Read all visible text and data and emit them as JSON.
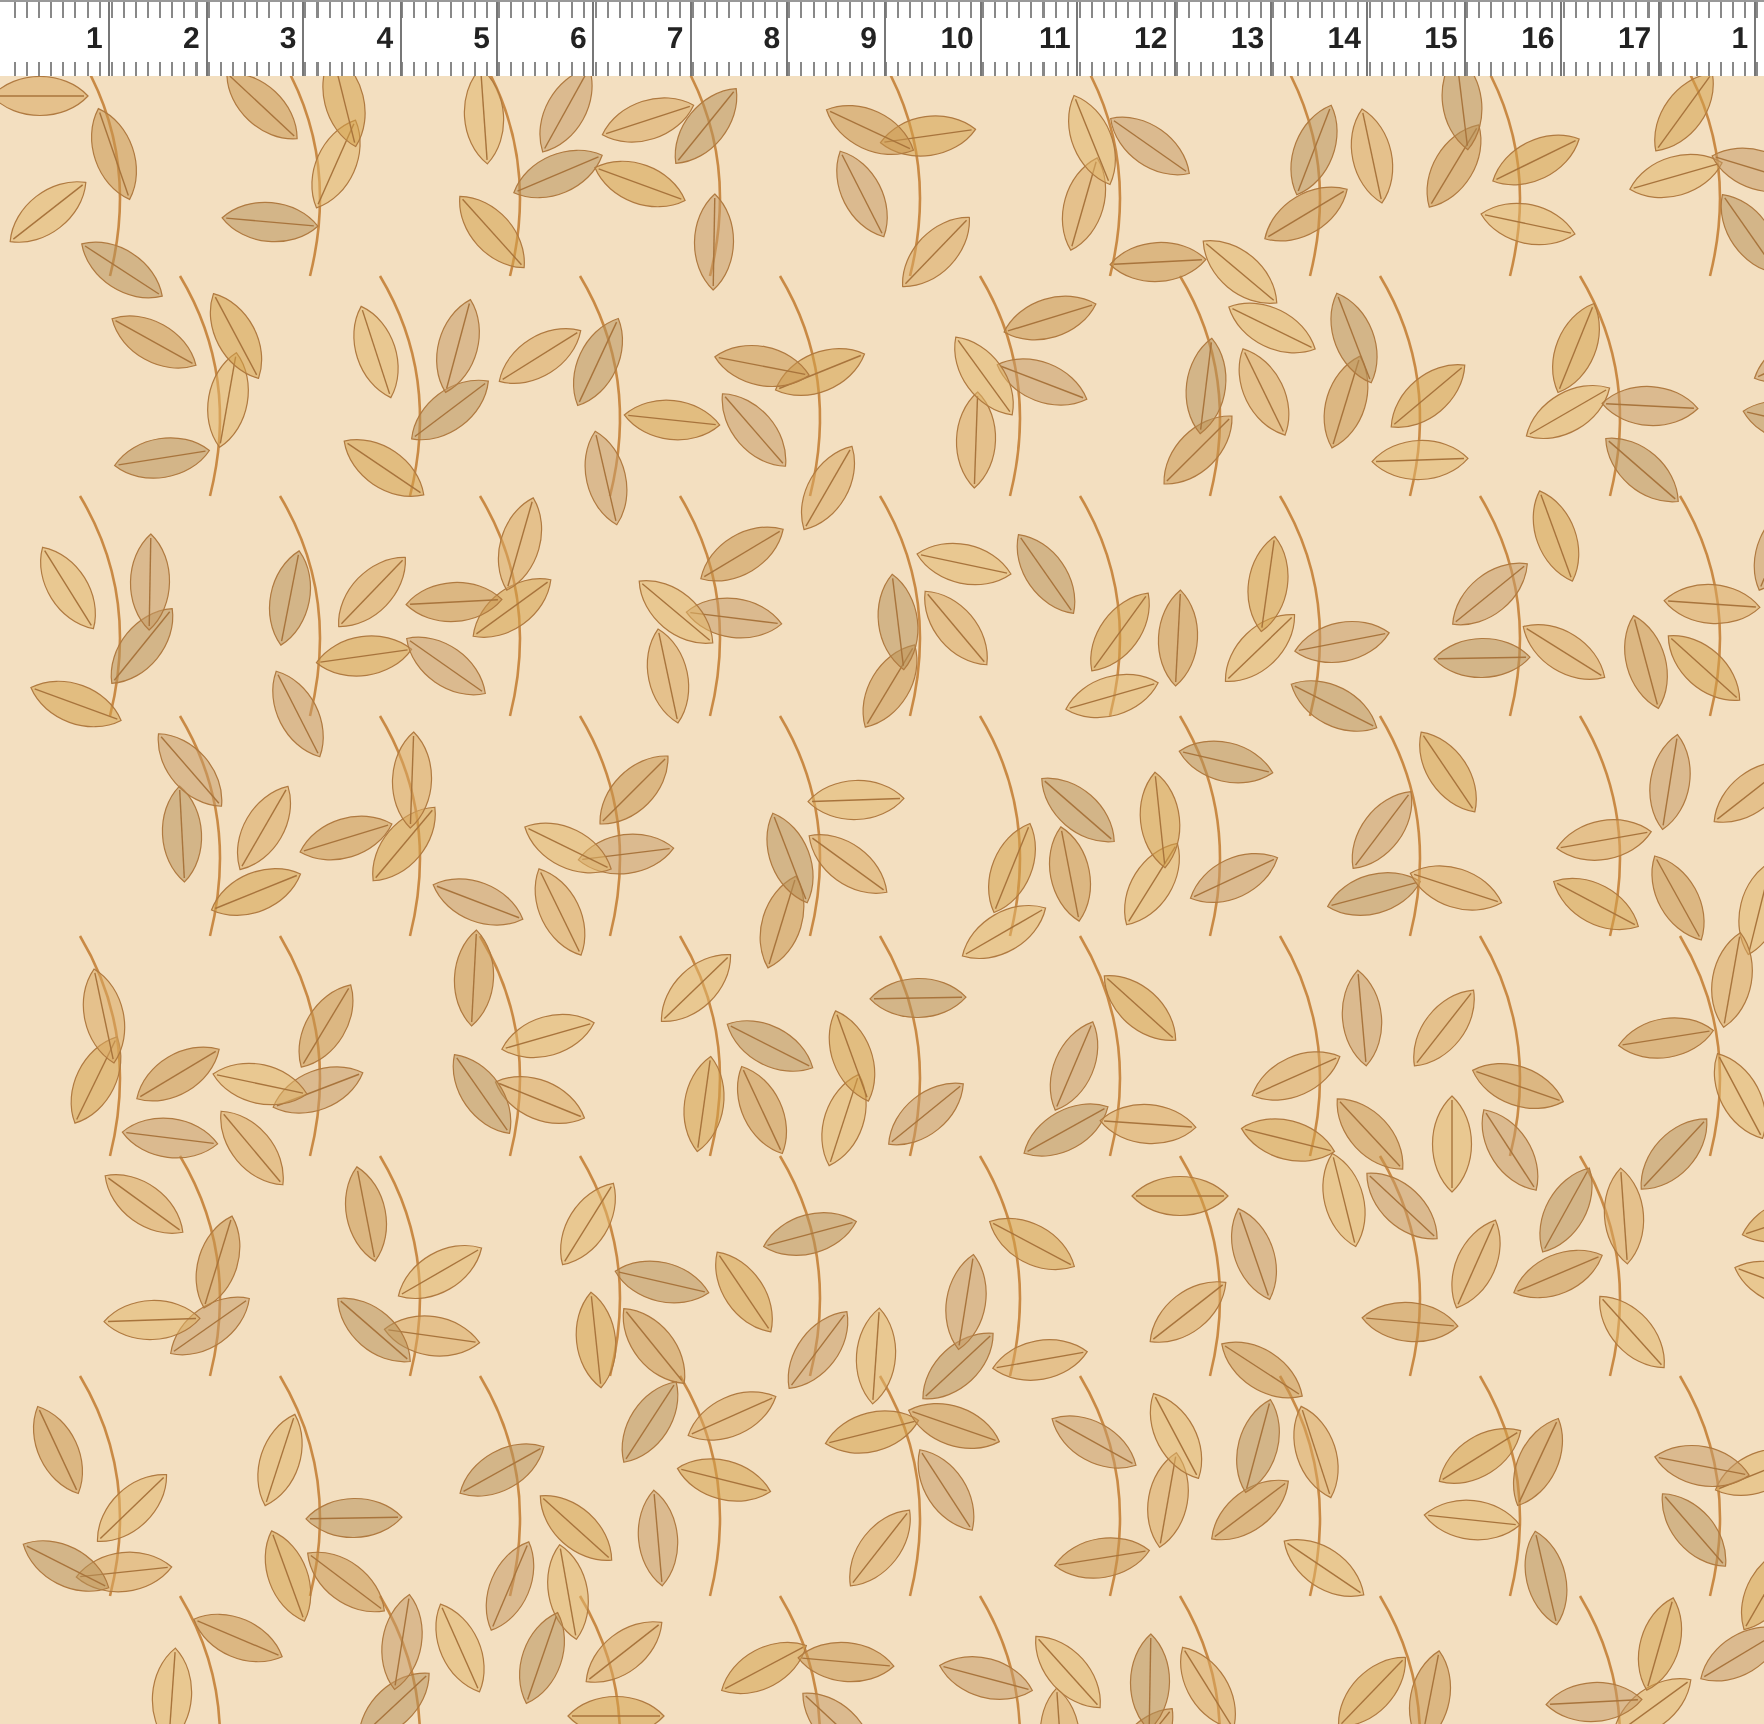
{
  "ruler": {
    "numbers": [
      "1",
      "2",
      "3",
      "4",
      "5",
      "6",
      "7",
      "8",
      "9",
      "10",
      "11",
      "12",
      "13",
      "14",
      "15",
      "16",
      "17",
      "1"
    ]
  }
}
